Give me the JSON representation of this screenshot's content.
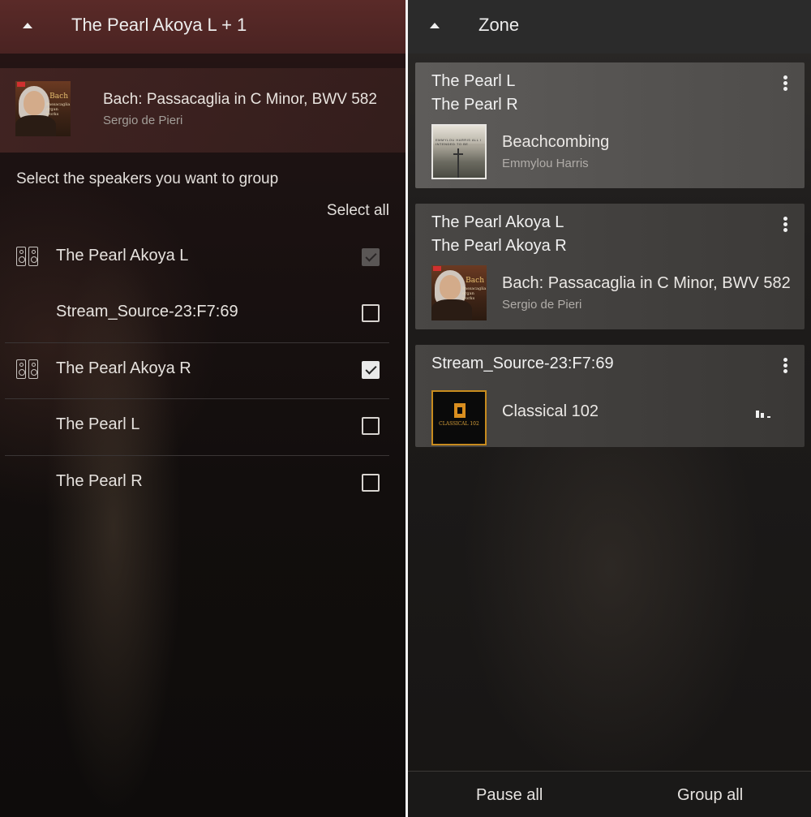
{
  "left": {
    "header": {
      "title": "The Pearl Akoya L + 1"
    },
    "now_playing": {
      "title": "Bach: Passacaglia in C Minor, BWV 582",
      "artist": "Sergio de Pieri"
    },
    "group_prompt": "Select the speakers you want to group",
    "select_all_label": "Select all",
    "speakers": [
      {
        "name": "The Pearl Akoya L",
        "icon": "speaker-pair-icon",
        "checked": true,
        "disabled": true
      },
      {
        "name": "Stream_Source-23:F7:69",
        "icon": null,
        "checked": false,
        "disabled": false
      },
      {
        "name": "The Pearl Akoya R",
        "icon": "speaker-pair-icon",
        "checked": true,
        "disabled": false
      },
      {
        "name": "The Pearl L",
        "icon": null,
        "checked": false,
        "disabled": false
      },
      {
        "name": "The Pearl R",
        "icon": null,
        "checked": false,
        "disabled": false
      }
    ]
  },
  "right": {
    "header": {
      "title": "Zone"
    },
    "zones": [
      {
        "speakers": [
          "The Pearl L",
          "The Pearl R"
        ],
        "title": "Beachcombing",
        "artist": "Emmylou Harris",
        "art": "beachcombing-album-art"
      },
      {
        "speakers": [
          "The Pearl Akoya L",
          "The Pearl Akoya R"
        ],
        "title": "Bach: Passacaglia in C Minor, BWV 582",
        "artist": "Sergio de Pieri",
        "art": "bach-album-art"
      },
      {
        "speakers": [
          "Stream_Source-23:F7:69"
        ],
        "title": "Classical 102",
        "artist": "",
        "art": "classical-102-logo",
        "playing_indicator": "equalizer-icon"
      }
    ],
    "footer": {
      "pause_all": "Pause all",
      "group_all": "Group all"
    }
  },
  "album_art_text": {
    "bach_label": "Bach",
    "bach_subtitle": "Passacaglia organ works",
    "beach_header": "EMMYLOU HARRIS ALL I INTENDED TO BE",
    "classical_label": "CLASSICAL 102"
  },
  "colors": {
    "left_header_bg": "#4a2322",
    "right_header_bg": "#2b2b2b",
    "checkbox_checked": "#e9e9e9",
    "classical_accent": "#c78b1e"
  }
}
